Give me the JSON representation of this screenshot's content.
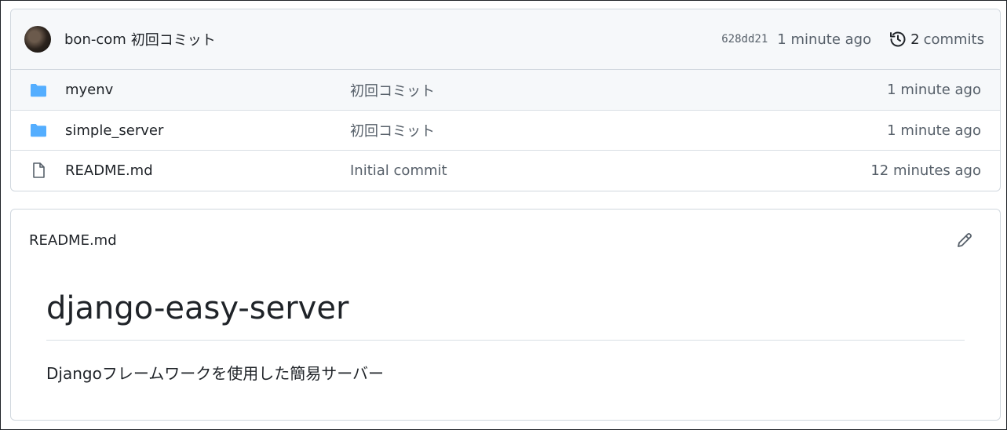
{
  "commit_header": {
    "author": "bon-com",
    "message": "初回コミット",
    "sha": "628dd21",
    "time": "1 minute ago",
    "commits_count": "2",
    "commits_label": "commits"
  },
  "files": [
    {
      "name": "myenv",
      "type": "folder",
      "message": "初回コミット",
      "time": "1 minute ago"
    },
    {
      "name": "simple_server",
      "type": "folder",
      "message": "初回コミット",
      "time": "1 minute ago"
    },
    {
      "name": "README.md",
      "type": "file",
      "message": "Initial commit",
      "time": "12 minutes ago"
    }
  ],
  "readme": {
    "filename": "README.md",
    "title": "django-easy-server",
    "text": "Djangoフレームワークを使用した簡易サーバー"
  },
  "colors": {
    "folder": "#54aeff",
    "muted": "#57606a",
    "text": "#1f2328"
  },
  "icons": {
    "avatar": "avatar",
    "history": "history-icon",
    "folder": "folder-icon",
    "file": "file-icon",
    "edit": "pencil-icon"
  }
}
